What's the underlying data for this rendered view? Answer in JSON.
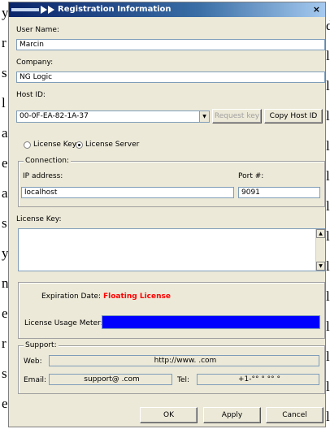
{
  "background_text": {
    "left": [
      "y",
      "r",
      "s",
      "l",
      "a",
      "e",
      "a",
      "s",
      "y",
      "n",
      "e",
      "r",
      "s",
      "e"
    ],
    "right": [
      "d",
      "l",
      "l",
      "l",
      "l",
      "l",
      "l",
      "l",
      "l",
      "l",
      "l",
      "l",
      "l",
      "l"
    ]
  },
  "window": {
    "title": "Registration Information",
    "close_glyph": "×"
  },
  "user_name": {
    "label": "User Name:",
    "value": "Marcin"
  },
  "company": {
    "label": "Company:",
    "value": "NG Logic"
  },
  "host_id": {
    "label": "Host ID:",
    "value": "00-0F-EA-82-1A-37",
    "request_key_label": "Request key",
    "copy_label": "Copy Host ID"
  },
  "license_mode": {
    "option_key": "License Key",
    "option_server": "License Server",
    "selected": "License Server"
  },
  "connection": {
    "group_label": "Connection:",
    "ip_label": "IP address:",
    "ip_value": "localhost",
    "port_label": "Port #:",
    "port_value": "9091"
  },
  "license_key": {
    "label": "License Key:",
    "value": ""
  },
  "status": {
    "expiration_label": "Expiration Date:",
    "expiration_value": "Floating License",
    "meter_label": "License Usage Meter:",
    "meter_fill": 1.0
  },
  "support": {
    "group_label": "Support:",
    "web_label": "Web:",
    "web_value": "http://www.              .com",
    "email_label": "Email:",
    "email_value": "support@              .com",
    "tel_label": "Tel:",
    "tel_value": "+1-°°  °    °° °"
  },
  "buttons": {
    "ok": "OK",
    "apply": "Apply",
    "cancel": "Cancel"
  },
  "colors": {
    "expiration": "#ff0000",
    "meter": "#0000ff",
    "title_start": "#0a246a"
  }
}
